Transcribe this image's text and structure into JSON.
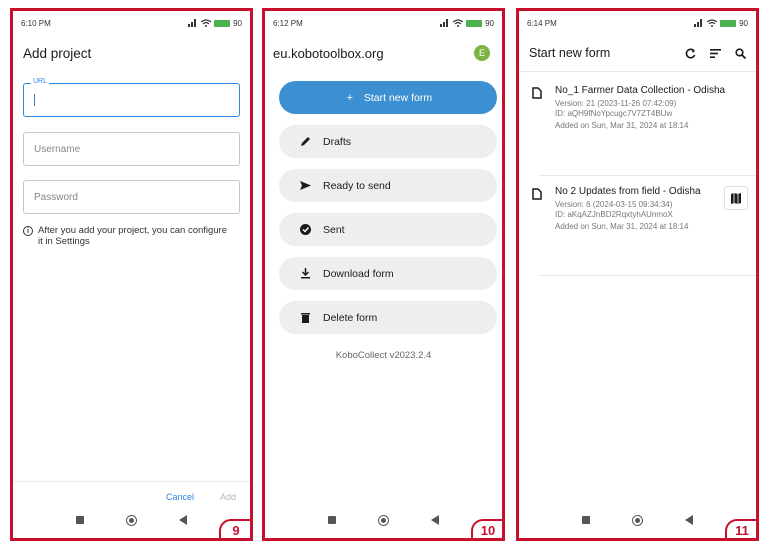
{
  "phones": [
    {
      "status": {
        "time": "6:10 PM",
        "battery": "90"
      },
      "title": "Add project",
      "url_label": "URL",
      "username_placeholder": "Username",
      "password_placeholder": "Password",
      "info_text": "After you add your project, you can configure it in Settings",
      "cancel": "Cancel",
      "add": "Add",
      "step": "9"
    },
    {
      "status": {
        "time": "6:12 PM",
        "battery": "90"
      },
      "server": "eu.kobotoolbox.org",
      "avatar_letter": "E",
      "buttons": {
        "start": "Start new form",
        "drafts": "Drafts",
        "ready": "Ready to send",
        "sent": "Sent",
        "download": "Download form",
        "delete": "Delete form"
      },
      "version": "KoboCollect v2023.2.4",
      "step": "10"
    },
    {
      "status": {
        "time": "6:14 PM",
        "battery": "90"
      },
      "title": "Start new form",
      "forms": [
        {
          "title": "No_1 Farmer Data Collection - Odisha",
          "version": "Version: 21 (2023-11-26 07:42:09)",
          "id": "ID: aQH9fNoYpcugc7V7ZT4BUw",
          "added": "Added on Sun, Mar 31, 2024 at 18:14"
        },
        {
          "title": "No 2 Updates from field - Odisha",
          "version": "Version: 6 (2024-03-15 09:34:34)",
          "id": "ID: aKqAZJnBD2RqxtyhAUnmoX",
          "added": "Added on Sun, Mar 31, 2024 at 18:14"
        }
      ],
      "step": "11"
    }
  ],
  "colors": {
    "frame": "#c8102e",
    "primary": "#3c8fd0",
    "accent_input": "#2e86de",
    "avatar": "#7cb342"
  }
}
